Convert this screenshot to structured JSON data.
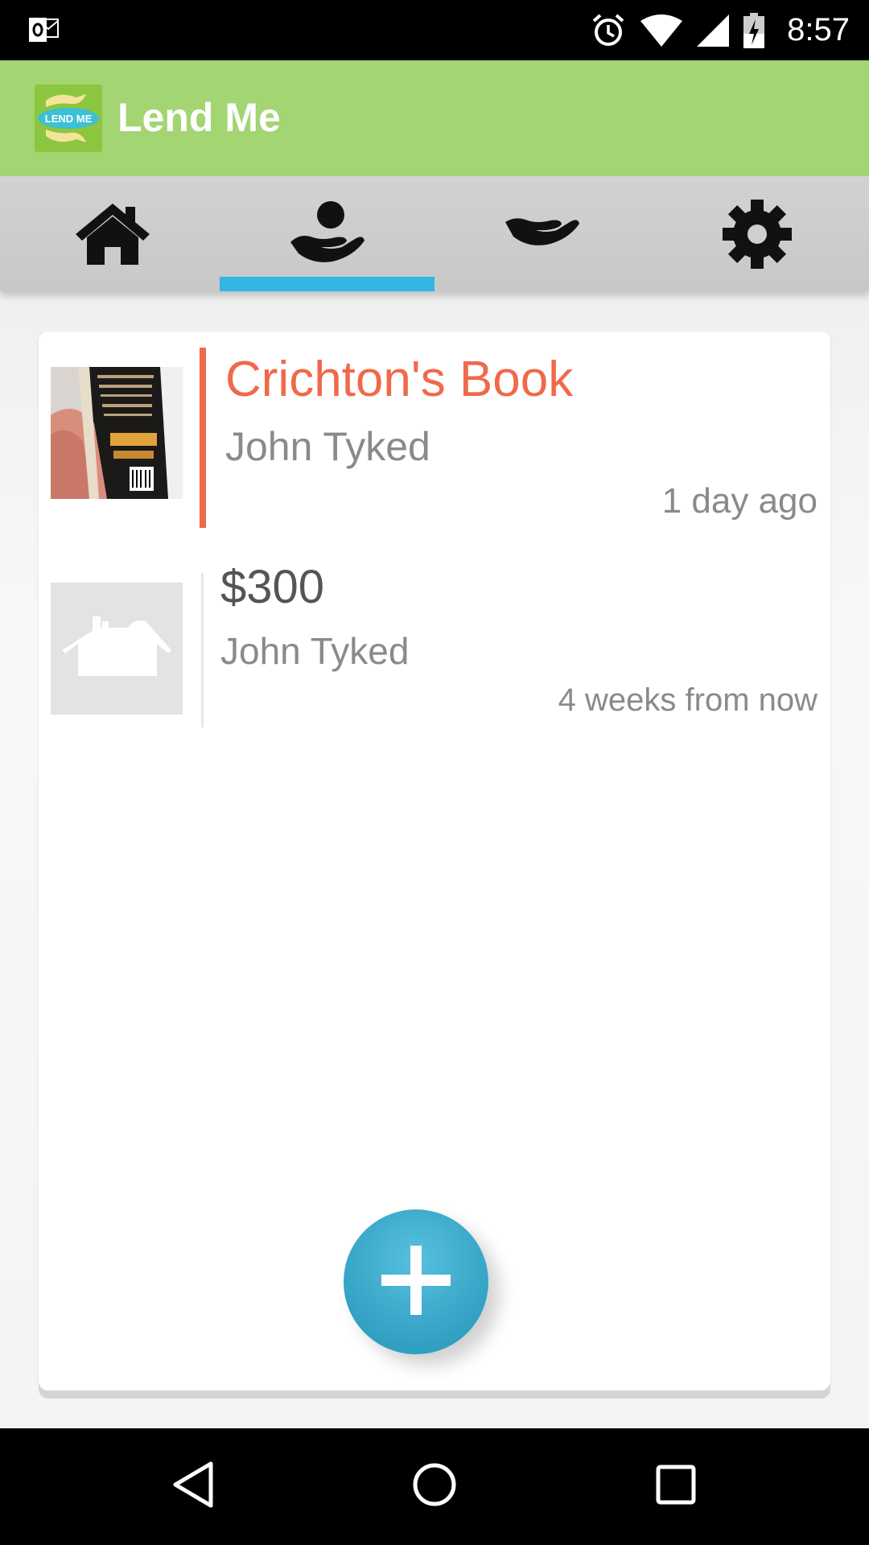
{
  "status_bar": {
    "time": "8:57",
    "icons": [
      "outlook-notification-icon",
      "alarm-icon",
      "wifi-icon",
      "signal-icon",
      "battery-charging-icon"
    ]
  },
  "app_bar": {
    "title": "Lend Me",
    "logo_text": "LEND ME",
    "color": "#a3d573"
  },
  "tabs": [
    {
      "icon": "home-icon",
      "selected": false
    },
    {
      "icon": "lend-out-icon",
      "selected": true
    },
    {
      "icon": "borrowed-icon",
      "selected": false
    },
    {
      "icon": "settings-icon",
      "selected": false
    }
  ],
  "accent": "#33b5e5",
  "items": [
    {
      "title": "Crichton's Book",
      "person": "John Tyked",
      "time": "1 day ago",
      "thumbnail": "book-photo",
      "highlight_color": "#f0694a"
    },
    {
      "title": "$300",
      "person": "John Tyked",
      "time": "4 weeks from now",
      "thumbnail": "placeholder-house-icon"
    }
  ],
  "fab": {
    "icon": "plus-icon"
  },
  "nav_bar": {
    "buttons": [
      "back-icon",
      "home-circle-icon",
      "recents-icon"
    ]
  }
}
